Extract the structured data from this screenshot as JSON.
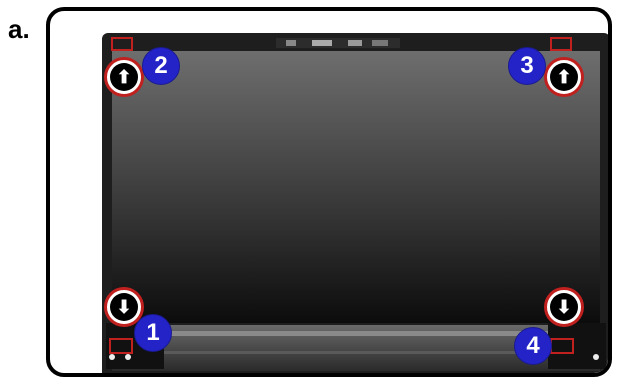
{
  "figure": {
    "step_label": "a.",
    "callouts": [
      {
        "number": "1",
        "direction": "down",
        "glyph": "⬇"
      },
      {
        "number": "2",
        "direction": "up",
        "glyph": "⬆"
      },
      {
        "number": "3",
        "direction": "up",
        "glyph": "⬆"
      },
      {
        "number": "4",
        "direction": "down",
        "glyph": "⬇"
      }
    ]
  },
  "colors": {
    "callout_badge": "#2323c8",
    "highlight_ring": "#c0201e",
    "screen": "#3a3a3a",
    "bezel": "#1e1e1e"
  }
}
